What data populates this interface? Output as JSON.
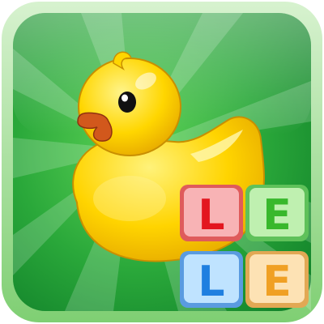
{
  "app_icon": {
    "icon_name": "rubber-duck-icon",
    "colors": {
      "background_green": "#1f9a32",
      "background_green_light": "#52cc4a",
      "frame_green": "#a9dfa0",
      "duck_yellow": "#ffd400",
      "duck_shadow": "#e0a800",
      "beak_orange": "#d2581c",
      "eye_black": "#111111"
    },
    "tiles": [
      {
        "letter": "L",
        "face": "#f8b3b5",
        "border": "#df5b5b",
        "letter_color": "#e3161f"
      },
      {
        "letter": "E",
        "face": "#bff0b0",
        "border": "#5fc15a",
        "letter_color": "#38b82c"
      },
      {
        "letter": "L",
        "face": "#bfe3ff",
        "border": "#5a9be0",
        "letter_color": "#1f7fe0"
      },
      {
        "letter": "E",
        "face": "#fde2b4",
        "border": "#e2a854",
        "letter_color": "#f0a024"
      }
    ]
  }
}
